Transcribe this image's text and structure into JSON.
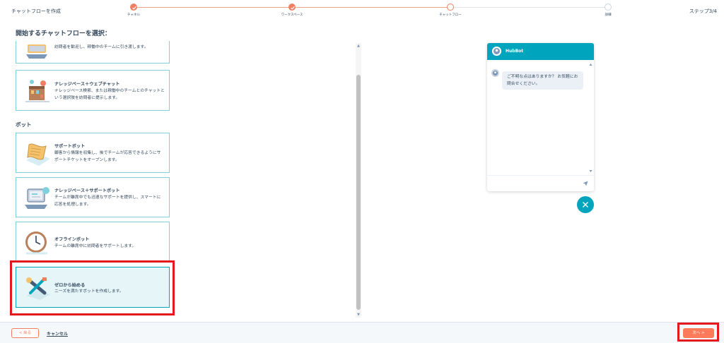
{
  "header": {
    "title": "チャットフローを作成",
    "step_counter": "ステップ3/4",
    "steps": [
      {
        "label": "チャネル",
        "state": "done"
      },
      {
        "label": "ワークスペース",
        "state": "done"
      },
      {
        "label": "チャットフロー",
        "state": "current"
      },
      {
        "label": "詳細",
        "state": "todo"
      }
    ]
  },
  "main": {
    "heading": "開始するチャットフローを選択：",
    "cards_top": [
      {
        "title": "",
        "desc": "訪問者を歓迎し、稼働中のチームに引き渡します。",
        "icon": "greeting-illustration"
      },
      {
        "title": "ナレッジベース＋ウェブチャット",
        "desc": "ナレッジベース検索、または稼働中のチームとのチャットという選択肢を訪問者に提示します。",
        "icon": "knowledge-webchat-illustration"
      }
    ],
    "section_bots": "ボット",
    "cards_bots": [
      {
        "title": "サポートボット",
        "desc": "顧客から情報を収集し、後でチームが応答できるようにサポートチケットをオープンします。",
        "icon": "support-bot-illustration"
      },
      {
        "title": "ナレッジベース＋サポートボット",
        "desc": "チームが離席中でも迅速なサポートを提供し、スマートに応答を処理します。",
        "icon": "knowledge-support-illustration"
      },
      {
        "title": "オフラインボット",
        "desc": "チームの離席中に訪問者をサポートします。",
        "icon": "offline-bot-illustration"
      },
      {
        "title": "ゼロから始める",
        "desc": "ニーズを満たすボットを作成します。",
        "icon": "tools-illustration"
      }
    ]
  },
  "preview": {
    "bot_name": "HubBot",
    "message": "ご不明な点はありますか？ お気軽にお問合せください。"
  },
  "footer": {
    "back_label": "< 戻る",
    "cancel_label": "キャンセル",
    "next_label": "次へ >"
  },
  "colors": {
    "accent": "#ff7a59",
    "teal": "#00a4bd",
    "highlight": "#e3191c"
  }
}
